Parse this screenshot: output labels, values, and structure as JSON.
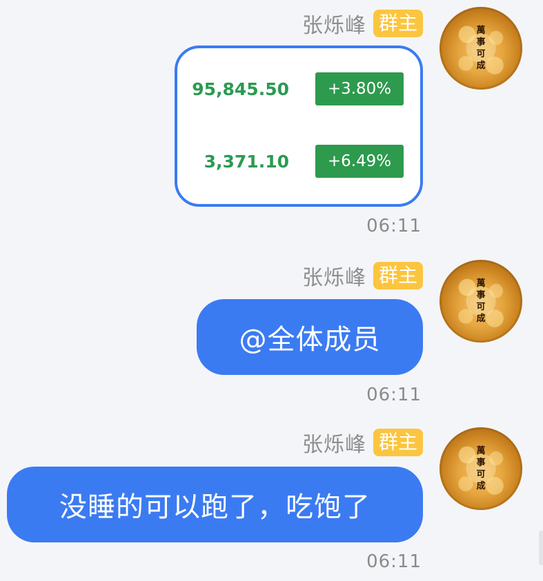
{
  "avatar": {
    "chars": [
      "萬",
      "事",
      "可",
      "成"
    ],
    "colors": {
      "outer": "#a9661a",
      "inner": "#f3c06a"
    }
  },
  "messages": [
    {
      "sender": "张烁峰",
      "role": "群主",
      "type": "stock_card",
      "stocks": [
        {
          "price": "95,845.50",
          "change": "+3.80%"
        },
        {
          "price": "3,371.10",
          "change": "+6.49%"
        }
      ],
      "time": "06:11"
    },
    {
      "sender": "张烁峰",
      "role": "群主",
      "type": "text",
      "text": "@全体成员",
      "time": "06:11"
    },
    {
      "sender": "张烁峰",
      "role": "群主",
      "type": "text",
      "text": "没睡的可以跑了，吃饱了",
      "time": "06:11"
    }
  ],
  "colors": {
    "bubble": "#3b7bf2",
    "badge": "#fbc53f",
    "positive": "#2e9a4e",
    "background": "#f4f5f8"
  }
}
